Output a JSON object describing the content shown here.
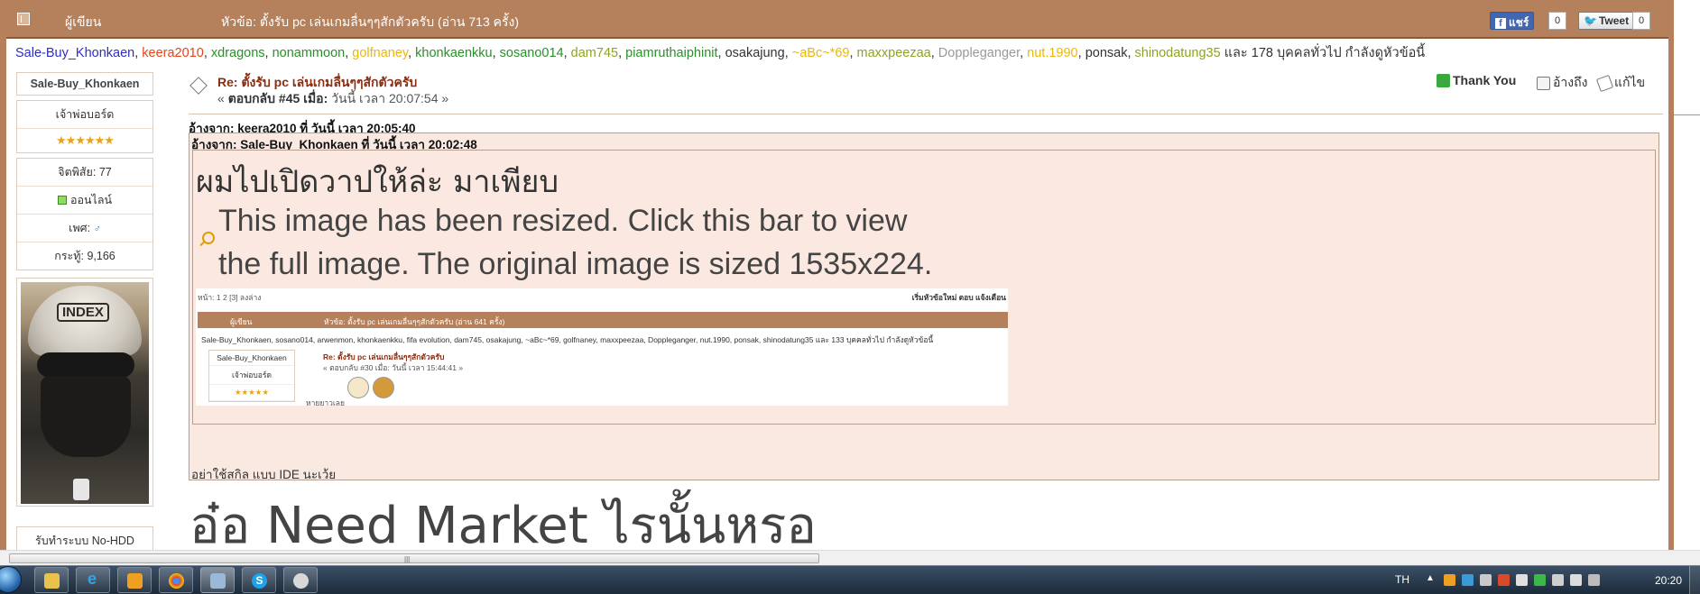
{
  "header": {
    "author_label": "ผู้เขียน",
    "topic_label": "หัวข้อ: ตั้งรับ pc เล่นเกมลื่นๆๆสักตัวครับ  (อ่าน 713 ครั้ง)",
    "facebook_share": "แชร์",
    "facebook_count": "0",
    "tweet_label": "Tweet",
    "tweet_count": "0"
  },
  "viewers": {
    "users": [
      {
        "name": "Sale-Buy_Khonkaen",
        "color": "#2f2fbf"
      },
      {
        "name": "keera2010",
        "color": "#e0461b"
      },
      {
        "name": "xdragons",
        "color": "#2a8f2a"
      },
      {
        "name": "nonammoon",
        "color": "#2a8f2a"
      },
      {
        "name": "golfnaney",
        "color": "#e8b80f"
      },
      {
        "name": "khonkaenkku",
        "color": "#2a8f2a"
      },
      {
        "name": "sosano014",
        "color": "#2a8f2a"
      },
      {
        "name": "dam745",
        "color": "#8ea322"
      },
      {
        "name": "piamruthaiphinit",
        "color": "#2a8f2a"
      },
      {
        "name": "osakajung",
        "color": "#333333"
      },
      {
        "name": "~aBc~*69",
        "color": "#e8b80f"
      },
      {
        "name": "maxxpeezaa",
        "color": "#8ea322"
      },
      {
        "name": "Doppleganger",
        "color": "#999999"
      },
      {
        "name": "nut.1990",
        "color": "#e8b80f"
      },
      {
        "name": "ponsak",
        "color": "#333333"
      },
      {
        "name": "shinodatung35",
        "color": "#8ea322"
      }
    ],
    "suffix": " และ 178 บุคคลทั่วไป กำลังดูหัวข้อนี้"
  },
  "profile": {
    "username": "Sale-Buy_Khonkaen",
    "rank": "เจ้าพ่อบอร์ด",
    "stars": "★★★★★★",
    "karma": "จิตพิสัย: 77",
    "online": "ออนไลน์",
    "gender_label": "เพศ:",
    "gender_icon": "♂",
    "posts": "กระทู้: 9,166",
    "helmet_text": "INDEX",
    "bottom_text": "รับทำระบบ No-HDD"
  },
  "post": {
    "title": "Re: ตั้งรับ pc เล่นเกมลื่นๆๆสักตัวครับ",
    "meta_prefix": "« ",
    "reply_label": "ตอบกลับ #45 เมื่อ:",
    "meta_time": " วันนี้ เวลา 20:07:54 »",
    "thank_you": "Thank You",
    "quote": "อ้างถึง",
    "edit": "แก้ไข"
  },
  "quote_outer": {
    "header": "อ้างจาก: keera2010 ที่ วันนี้ เวลา 20:05:40",
    "text": "อย่าใช้สกิล แบบ IDE  นะเว้ย"
  },
  "quote_inner": {
    "header": "อ้างจาก: Sale-Buy_Khonkaen ที่ วันนี้ เวลา 20:02:48",
    "big_text": "ผมไปเปิดวาปให้ล่ะ มาเพียบ",
    "resize_line1": "This image has been resized. Click this bar to view",
    "resize_line2": "the full image. The original image is sized 1535x224."
  },
  "thumbnail": {
    "pager": "หน้า: 1 2 [3]   ลงล่าง",
    "right_links": "เริ่มหัวข้อใหม่   ตอบ   แจ้งเตือน",
    "author": "ผู้เขียน",
    "topic": "หัวข้อ: ตั้งรับ pc เล่นเกมลื่นๆๆสักตัวครับ  (อ่าน 641 ครั้ง)",
    "viewers": "Sale-Buy_Khonkaen, sosano014, arwenmon, khonkaenkku, fifa evolution, dam745, osakajung, ~aBc~*69, golfnaney, maxxpeezaa, Doppleganger, nut.1990, ponsak, shinodatung35 และ 133 บุคคลทั่วไป กำลังดูหัวข้อนี้",
    "prof_name": "Sale-Buy_Khonkaen",
    "prof_rank": "เจ้าพ่อบอร์ด",
    "prof_stars": "★★★★★",
    "post_title": "Re: ตั้งรับ pc เล่นเกมลื่นๆๆสักตัวครับ",
    "post_meta": "« ตอบกลับ #30 เมื่อ: วันนี้ เวลา 15:44:41 »",
    "foot": "หายยาวเลย"
  },
  "reply_text": "อ๋อ Need Market ไรนั้นหรอ",
  "taskbar": {
    "apps": [
      "file-explorer",
      "internet-explorer",
      "media-player",
      "chrome",
      "network-tool",
      "skype",
      "game-launcher"
    ],
    "language": "TH",
    "tray_arrow": "▲",
    "clock": "20:20"
  }
}
